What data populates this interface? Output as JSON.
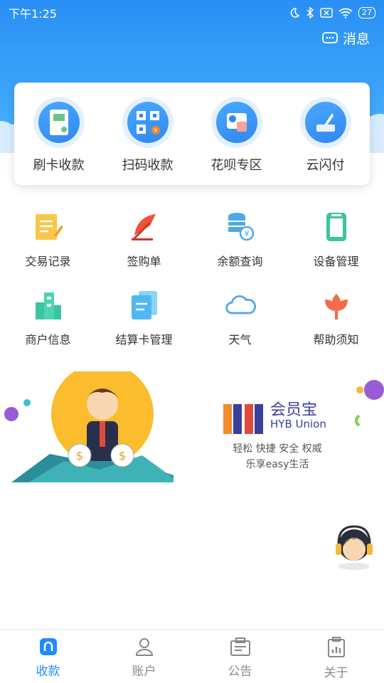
{
  "status_bar": {
    "time": "下午1:25",
    "battery": "27"
  },
  "header": {
    "message_label": "消息"
  },
  "quick_actions": [
    {
      "label": "刷卡收款",
      "icon": "card-reader-icon"
    },
    {
      "label": "扫码收款",
      "icon": "qr-scan-icon"
    },
    {
      "label": "花呗专区",
      "icon": "huabei-icon"
    },
    {
      "label": "云闪付",
      "icon": "cloud-pay-icon"
    }
  ],
  "grid": [
    {
      "label": "交易记录",
      "icon": "notepad-pencil-icon",
      "color": "#f5b93a"
    },
    {
      "label": "签购单",
      "icon": "feather-icon",
      "color": "#f0513b"
    },
    {
      "label": "余额查询",
      "icon": "coins-search-icon",
      "color": "#4fa8e8"
    },
    {
      "label": "设备管理",
      "icon": "device-icon",
      "color": "#3bc4a0"
    },
    {
      "label": "商户信息",
      "icon": "buildings-icon",
      "color": "#3bc4a0"
    },
    {
      "label": "结算卡管理",
      "icon": "cards-icon",
      "color": "#4fb8f0"
    },
    {
      "label": "天气",
      "icon": "cloud-icon",
      "color": "#4fa8e8"
    },
    {
      "label": "帮助须知",
      "icon": "flower-icon",
      "color": "#f46a4a"
    }
  ],
  "banner": {
    "brand_name": "会员宝",
    "brand_en": "HYB Union",
    "slogan_line1": "轻松 快捷 安全 权威",
    "slogan_line2": "乐享easy生活"
  },
  "tabs": [
    {
      "label": "收款",
      "icon": "home-icon",
      "active": true
    },
    {
      "label": "账户",
      "icon": "user-icon",
      "active": false
    },
    {
      "label": "公告",
      "icon": "notice-icon",
      "active": false
    },
    {
      "label": "关于",
      "icon": "clipboard-chart-icon",
      "active": false
    }
  ],
  "colors": {
    "primary": "#1e8cff",
    "hero": "#3aa2fb"
  }
}
